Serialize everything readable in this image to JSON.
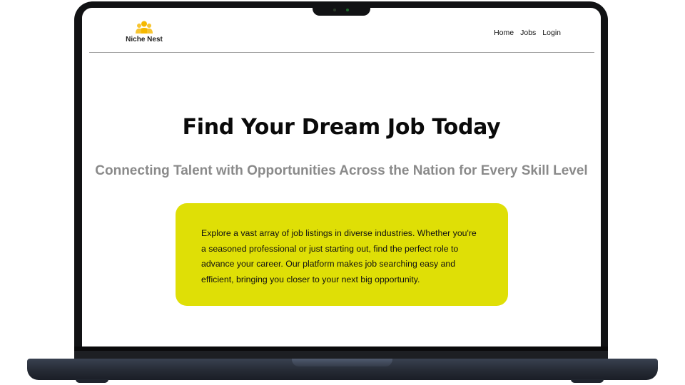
{
  "site": {
    "brand": "Niche Nest",
    "logo_icon": "group-people-icon",
    "accent_color": "#f5b800"
  },
  "nav": {
    "items": [
      {
        "label": "Home"
      },
      {
        "label": "Jobs"
      },
      {
        "label": "Login"
      }
    ]
  },
  "hero": {
    "title": "Find Your Dream Job Today",
    "subtitle": "Connecting Talent with Opportunities Across the Nation for Every Skill Level"
  },
  "info_card": {
    "text": "Explore a vast array of job listings in diverse industries. Whether you're a seasoned professional or just starting out, find the perfect role to advance your career. Our platform makes job searching easy and efficient, bringing you closer to your next big opportunity.",
    "background": "#dfdf06"
  }
}
